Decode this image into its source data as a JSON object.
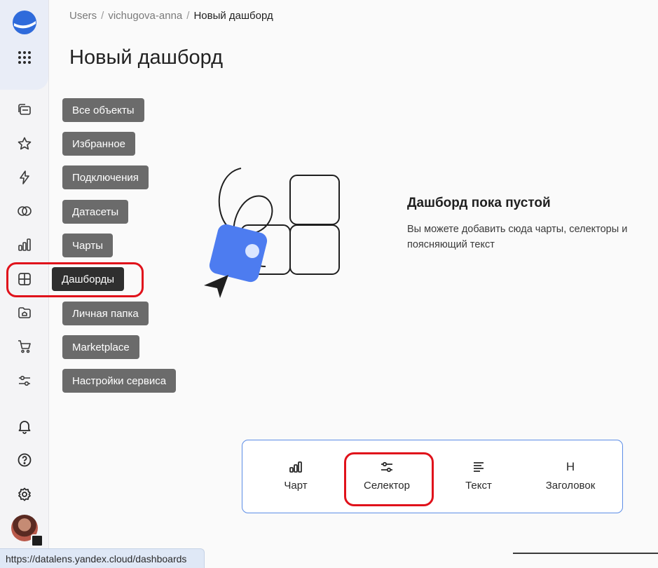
{
  "breadcrumb": {
    "items": [
      "Users",
      "vichugova-anna"
    ],
    "separator": "/",
    "current": "Новый дашборд"
  },
  "page_title": "Новый дашборд",
  "nav_menu": {
    "items": [
      {
        "label": "Все объекты",
        "icon": "folders-icon"
      },
      {
        "label": "Избранное",
        "icon": "star-icon"
      },
      {
        "label": "Подключения",
        "icon": "lightning-icon"
      },
      {
        "label": "Датасеты",
        "icon": "datasets-icon"
      },
      {
        "label": "Чарты",
        "icon": "bar-chart-icon"
      },
      {
        "label": "Дашборды",
        "icon": "dashboard-icon",
        "active": true
      },
      {
        "label": "Личная папка",
        "icon": "home-folder-icon"
      },
      {
        "label": "Marketplace",
        "icon": "cart-icon"
      },
      {
        "label": "Настройки сервиса",
        "icon": "sliders-icon"
      }
    ]
  },
  "rail_bottom_icons": [
    "bell-icon",
    "help-icon",
    "settings-icon",
    "avatar"
  ],
  "empty_state": {
    "title": "Дашборд пока пустой",
    "description": "Вы можете добавить сюда чарты, селекторы и поясняющий текст"
  },
  "add_bar": {
    "items": [
      {
        "label": "Чарт",
        "icon": "chart-icon"
      },
      {
        "label": "Селектор",
        "icon": "selector-icon"
      },
      {
        "label": "Текст",
        "icon": "text-icon"
      },
      {
        "label": "Заголовок",
        "icon": "heading-icon",
        "glyph": "H"
      }
    ]
  },
  "status_url": "https://datalens.yandex.cloud/dashboards",
  "colors": {
    "accent": "#2f6bdb",
    "highlight": "#e0121b",
    "tooltip": "#6b6b6b",
    "tooltip_active": "#2f2f2f"
  }
}
